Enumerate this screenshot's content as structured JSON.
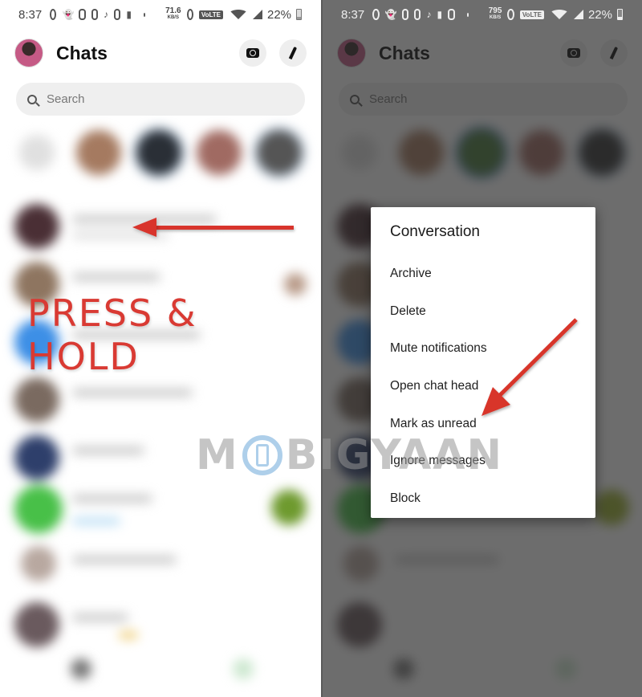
{
  "status_left": {
    "time": "8:37",
    "net_speed": "71.6",
    "net_unit": "KB/S",
    "volte": "VoLTE",
    "battery": "22%",
    "icons": [
      "whatsapp-icon",
      "snapchat-icon",
      "instagram-icon",
      "app-icon",
      "tiktok-icon",
      "battery-saver-icon",
      "instagram-icon",
      "dot-icon",
      "alarm-icon",
      "wifi-icon",
      "signal-icon",
      "battery-icon"
    ]
  },
  "status_right": {
    "time": "8:37",
    "net_speed": "795",
    "net_unit": "KB/S",
    "volte": "VoLTE",
    "battery": "22%"
  },
  "header": {
    "title": "Chats",
    "camera_icon": "camera-icon",
    "compose_icon": "pencil-icon"
  },
  "search": {
    "placeholder": "Search"
  },
  "annotation_left": {
    "label": "PRESS & HOLD",
    "arrow_color": "#d8342c"
  },
  "context_menu": {
    "title": "Conversation",
    "items": [
      {
        "label": "Archive"
      },
      {
        "label": "Delete"
      },
      {
        "label": "Mute notifications"
      },
      {
        "label": "Open chat head"
      },
      {
        "label": "Mark as unread"
      },
      {
        "label": "Ignore messages"
      },
      {
        "label": "Block"
      }
    ],
    "highlighted": "Mark as unread"
  },
  "watermark": {
    "prefix": "M",
    "suffix": "BIGYAAN"
  },
  "colors": {
    "annotation_red": "#d8342c",
    "dim_overlay": "#5a5a5a",
    "search_bg": "#efefef"
  }
}
